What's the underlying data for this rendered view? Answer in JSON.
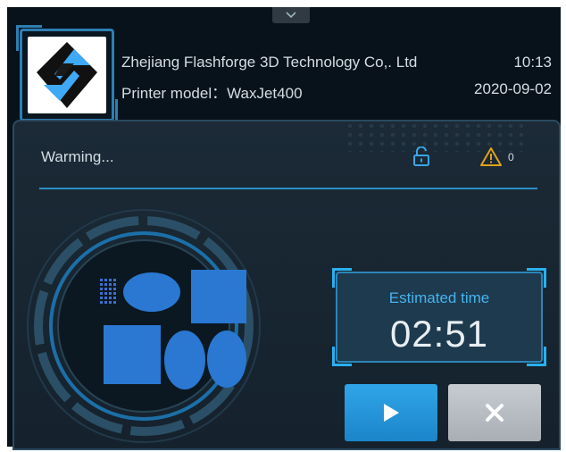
{
  "header": {
    "company": "Zhejiang Flashforge 3D Technology Co,. Ltd",
    "time": "10:13",
    "model_label": "Printer model：",
    "model_value": "WaxJet400",
    "date": "2020-09-02"
  },
  "status": {
    "text": "Warming...",
    "warning_count": "0"
  },
  "estimate": {
    "label": "Estimated time",
    "value": "02:51"
  },
  "icons": {
    "expand": "chevron-down-icon",
    "lock": "lock-open-icon",
    "warning": "warning-icon",
    "start": "play-icon",
    "cancel": "close-icon",
    "logo": "flashforge-logo"
  },
  "colors": {
    "accent": "#2ab0f0",
    "start_button": "#1f8fd4",
    "cancel_button": "#b5babf",
    "warning": "#e0a21a",
    "shape_fill": "#1f6dbf"
  }
}
